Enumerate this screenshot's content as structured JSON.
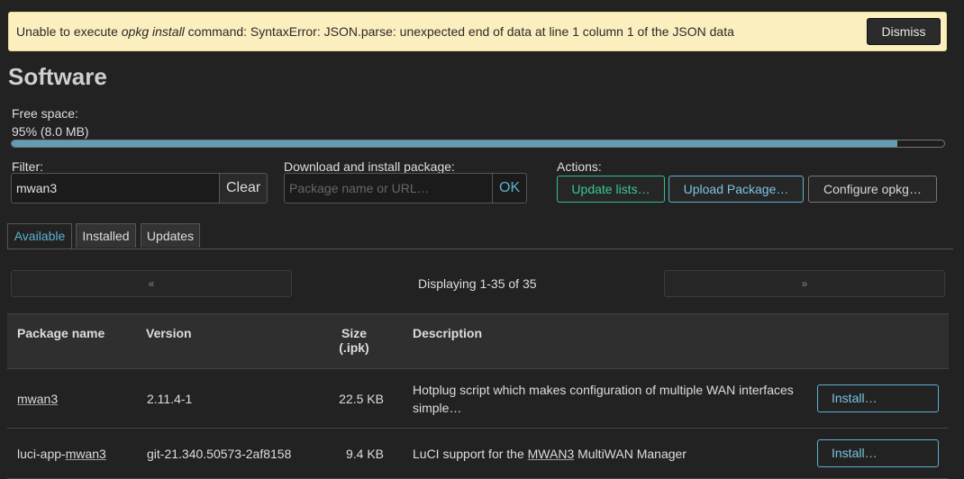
{
  "alert": {
    "text_before": "Unable to execute ",
    "command": "opkg install",
    "text_after": " command: SyntaxError: JSON.parse: unexpected end of data at line 1 column 1 of the JSON data",
    "dismiss_label": "Dismiss"
  },
  "page": {
    "title": "Software"
  },
  "free_space": {
    "label": "Free space:",
    "value": "95% (8.0 MB)",
    "fraction": 0.95
  },
  "filter": {
    "label": "Filter:",
    "value": "mwan3",
    "clear_label": "Clear"
  },
  "download": {
    "label": "Download and install package:",
    "placeholder": "Package name or URL…",
    "ok_label": "OK"
  },
  "actions": {
    "label": "Actions:",
    "update_lists": "Update lists…",
    "upload_package": "Upload Package…",
    "configure_opkg": "Configure opkg…"
  },
  "tabs": [
    {
      "label": "Available",
      "active": true
    },
    {
      "label": "Installed",
      "active": false
    },
    {
      "label": "Updates",
      "active": false
    }
  ],
  "pager": {
    "prev": "«",
    "next": "»",
    "status": "Displaying 1-35 of 35"
  },
  "table": {
    "headers": {
      "name": "Package name",
      "version": "Version",
      "size": "Size",
      "size_unit": "(.ipk)",
      "description": "Description"
    },
    "rows": [
      {
        "name": "mwan3",
        "version": "2.11.4-1",
        "size": "22.5 KB",
        "description_line1": "Hotplug script which makes configuration of multiple WAN interfaces",
        "description_line2": "simple…",
        "action": "Install…"
      },
      {
        "name_prefix": "luci-app-",
        "name_link": "mwan3",
        "version": "git-21.340.50573-2af8158",
        "size": "9.4 KB",
        "description_before": "LuCI support for the ",
        "description_link": "MWAN3",
        "description_after": " MultiWAN Manager",
        "action": "Install…"
      }
    ]
  },
  "colors": {
    "accent": "#5cb0d0",
    "success": "#38c98f",
    "alert_bg": "#fcefbf",
    "background": "#222222"
  }
}
